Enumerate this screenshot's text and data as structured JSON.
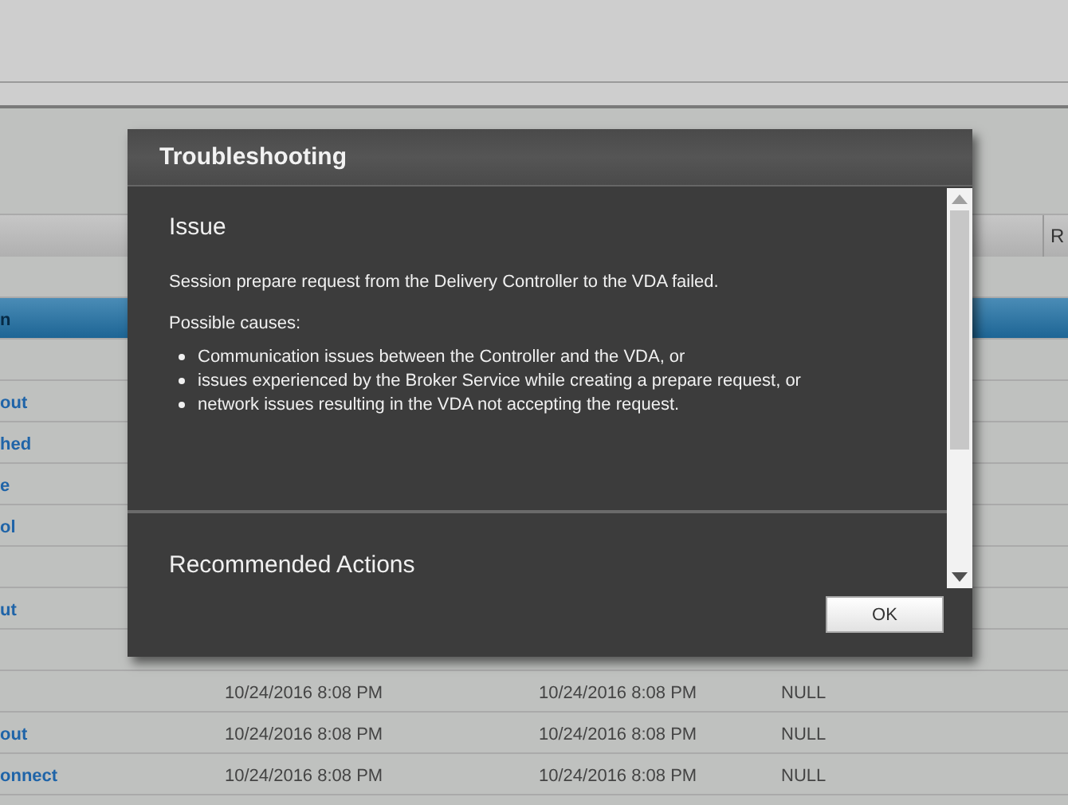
{
  "table": {
    "header": {
      "column_5": "R"
    },
    "rows": [
      {
        "column_1": "",
        "selected": false
      },
      {
        "column_1": "n",
        "selected": true
      },
      {
        "column_1": "",
        "selected": false
      },
      {
        "column_1": "out",
        "selected": false
      },
      {
        "column_1": "hed",
        "selected": false
      },
      {
        "column_1": "e",
        "selected": false
      },
      {
        "column_1": "ol",
        "selected": false
      },
      {
        "column_1": "",
        "selected": false
      },
      {
        "column_1": "ut",
        "selected": false
      },
      {
        "column_1": "",
        "selected": false
      },
      {
        "column_1": "",
        "column_2": "10/24/2016 8:08 PM",
        "column_3": "10/24/2016 8:08 PM",
        "column_4": "NULL",
        "selected": false
      },
      {
        "column_1": "out",
        "column_2": "10/24/2016 8:08 PM",
        "column_3": "10/24/2016 8:08 PM",
        "column_4": "NULL",
        "selected": false
      },
      {
        "column_1": "onnect",
        "column_2": "10/24/2016 8:08 PM",
        "column_3": "10/24/2016 8:08 PM",
        "column_4": "NULL",
        "selected": false
      }
    ]
  },
  "dialog": {
    "title": "Troubleshooting",
    "issue_heading": "Issue",
    "issue_text": "Session prepare request from the Delivery Controller to the VDA failed.",
    "causes_label": "Possible causes:",
    "causes": [
      "Communication issues between the Controller and the VDA, or",
      "issues experienced by the Broker Service while creating a prepare request, or",
      "network issues resulting in the VDA not accepting the request."
    ],
    "actions_heading": "Recommended Actions",
    "ok_button": "OK"
  }
}
